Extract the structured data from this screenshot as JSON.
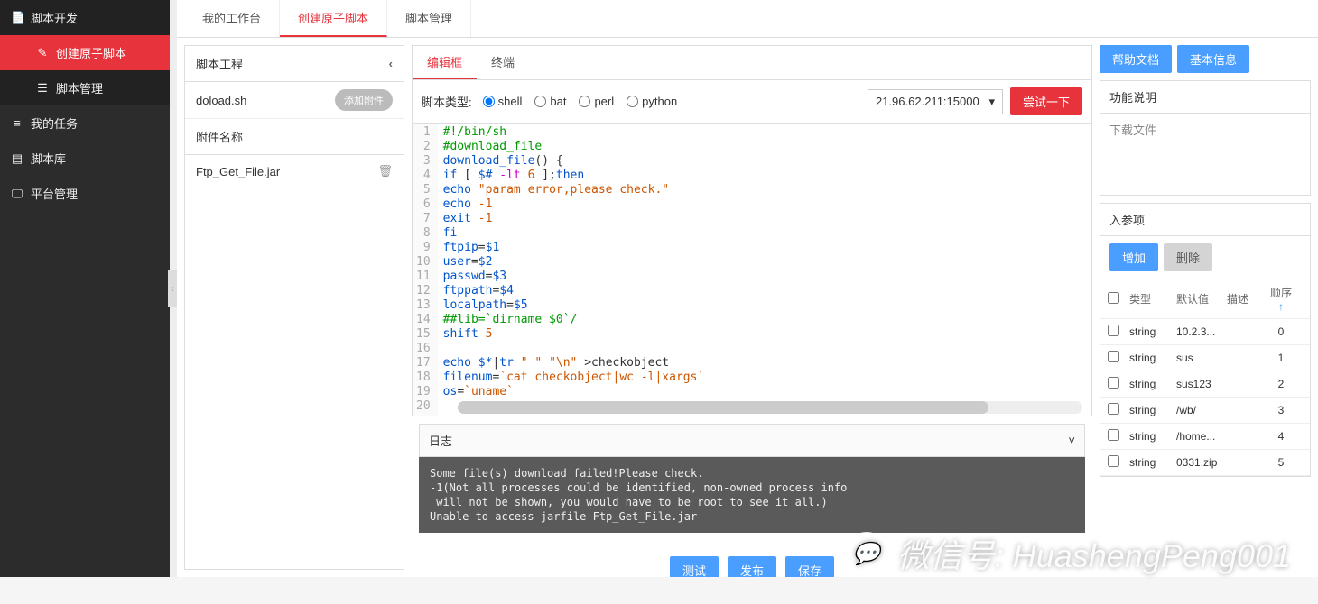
{
  "sidebar": {
    "header": "脚本开发",
    "items": [
      {
        "label": "创建原子脚本",
        "icon": "✎"
      },
      {
        "label": "脚本管理",
        "icon": "☰"
      }
    ],
    "nav": [
      {
        "label": "我的任务",
        "icon": "≡"
      },
      {
        "label": "脚本库",
        "icon": "▤"
      },
      {
        "label": "平台管理",
        "icon": "🖵"
      }
    ]
  },
  "tabs": [
    "我的工作台",
    "创建原子脚本",
    "脚本管理"
  ],
  "activeTab": "创建原子脚本",
  "leftPanel": {
    "title": "脚本工程",
    "filename": "doload.sh",
    "addAttach": "添加附件",
    "attachTitle": "附件名称",
    "attachment": "Ftp_Get_File.jar"
  },
  "editorTabs": [
    "编辑框",
    "终端"
  ],
  "activeEditorTab": "编辑框",
  "scriptTypeLabel": "脚本类型:",
  "scriptTypes": [
    "shell",
    "bat",
    "perl",
    "python"
  ],
  "selectedScriptType": "shell",
  "hostSelect": "21.96.62.211:15000",
  "tryBtn": "尝试一下",
  "codeLines": [
    {
      "n": 1,
      "html": "<span class='cmt'>#!/bin/sh</span>"
    },
    {
      "n": 2,
      "html": "<span class='cmt'>#download_file</span>"
    },
    {
      "n": 3,
      "html": "<span class='var'>download_file</span>() {"
    },
    {
      "n": 4,
      "html": "<span class='kw'>if</span> [ <span class='var'>$#</span> <span class='op'>-lt</span> <span class='num'>6</span> ];<span class='kw'>then</span>"
    },
    {
      "n": 5,
      "html": "<span class='kw'>echo</span> <span class='str'>\"param error,please check.\"</span>"
    },
    {
      "n": 6,
      "html": "<span class='kw'>echo</span> <span class='num'>-1</span>"
    },
    {
      "n": 7,
      "html": "<span class='kw'>exit</span> <span class='num'>-1</span>"
    },
    {
      "n": 8,
      "html": "<span class='kw'>fi</span>"
    },
    {
      "n": 9,
      "html": "<span class='var'>ftpip</span>=<span class='var'>$1</span>"
    },
    {
      "n": 10,
      "html": "<span class='var'>user</span>=<span class='var'>$2</span>"
    },
    {
      "n": 11,
      "html": "<span class='var'>passwd</span>=<span class='var'>$3</span>"
    },
    {
      "n": 12,
      "html": "<span class='var'>ftppath</span>=<span class='var'>$4</span>"
    },
    {
      "n": 13,
      "html": "<span class='var'>localpath</span>=<span class='var'>$5</span>"
    },
    {
      "n": 14,
      "html": "<span class='cmt'>##lib=`dirname $0`/</span>"
    },
    {
      "n": 15,
      "html": "<span class='kw'>shift</span> <span class='num'>5</span>"
    },
    {
      "n": 16,
      "html": ""
    },
    {
      "n": 17,
      "html": "<span class='kw'>echo</span> <span class='var'>$*</span>|<span class='kw'>tr</span> <span class='str'>\" \"</span> <span class='str'>\"\\n\"</span> &gt;checkobject"
    },
    {
      "n": 18,
      "html": "<span class='var'>filenum</span>=<span class='str'>`cat checkobject|wc -l|xargs`</span>"
    },
    {
      "n": 19,
      "html": "<span class='var'>os</span>=<span class='str'>`uname`</span>"
    },
    {
      "n": 20,
      "html": ""
    }
  ],
  "log": {
    "title": "日志",
    "body": "Some file(s) download failed!Please check.\n-1(Not all processes could be identified, non-owned process info\n will not be shown, you would have to be root to see it all.)\nUnable to access jarfile Ftp_Get_File.jar"
  },
  "rightPanel": {
    "helpBtn": "帮助文档",
    "infoBtn": "基本信息",
    "funcTitle": "功能说明",
    "funcBody": "下载文件",
    "paramTitle": "入参项",
    "addBtn": "增加",
    "delBtn": "删除",
    "cols": {
      "type": "类型",
      "default": "默认值",
      "desc": "描述",
      "order": "顺序"
    },
    "rows": [
      {
        "type": "string",
        "default": "10.2.3...",
        "order": "0"
      },
      {
        "type": "string",
        "default": "sus",
        "order": "1"
      },
      {
        "type": "string",
        "default": "sus123",
        "order": "2"
      },
      {
        "type": "string",
        "default": "/wb/",
        "order": "3"
      },
      {
        "type": "string",
        "default": "/home...",
        "order": "4"
      },
      {
        "type": "string",
        "default": "0331.zip",
        "order": "5"
      }
    ]
  },
  "bottomActions": [
    "测试",
    "发布",
    "保存"
  ],
  "watermark": "微信号: HuashengPeng001"
}
